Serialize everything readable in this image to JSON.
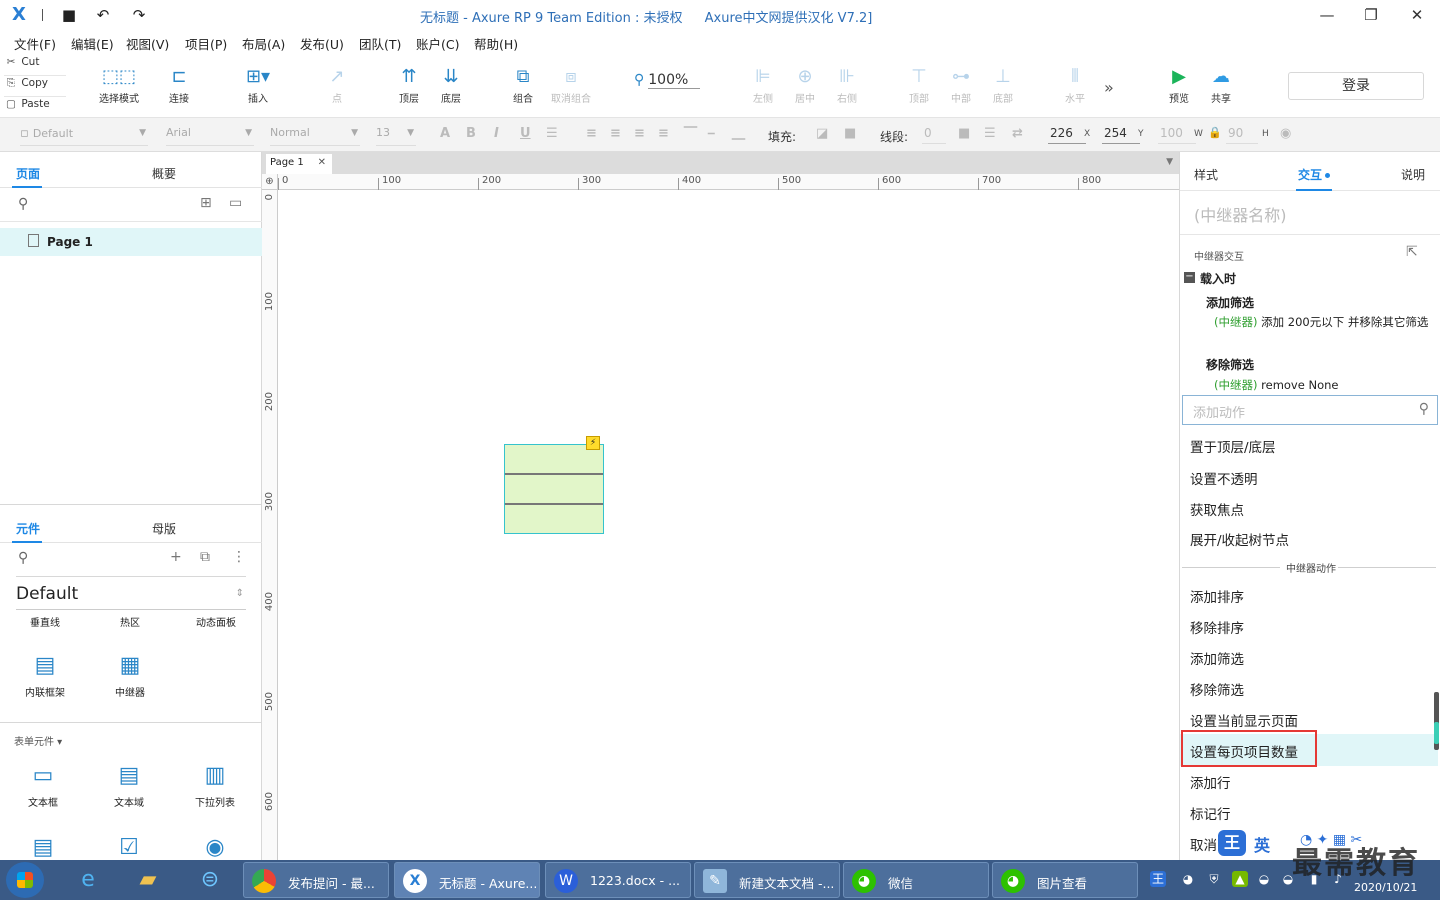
{
  "titlebar": {
    "title": "无标题 - Axure RP 9 Team Edition : ",
    "unlicensed": "未授权",
    "translation": "Axure中文网提供汉化 V7.2]"
  },
  "menu": [
    "文件(F)",
    "编辑(E)",
    "视图(V)",
    "项目(P)",
    "布局(A)",
    "发布(U)",
    "团队(T)",
    "账户(C)",
    "帮助(H)"
  ],
  "clipboard": {
    "cut": "Cut",
    "copy": "Copy",
    "paste": "Paste"
  },
  "toolbar": {
    "select_mode": "选择模式",
    "connect": "连接",
    "insert": "插入",
    "point": "点",
    "top_layer": "顶层",
    "bottom_layer": "底层",
    "group": "组合",
    "ungroup": "取消组合",
    "zoom": "100%",
    "align_left": "左侧",
    "align_center": "居中",
    "align_right": "右侧",
    "align_top": "顶部",
    "align_middle": "中部",
    "align_bottom": "底部",
    "horizontal": "水平",
    "preview": "预览",
    "share": "共享",
    "login": "登录"
  },
  "formatbar": {
    "style": "Default",
    "font": "Arial",
    "weight": "Normal",
    "size": "13",
    "fill_label": "填充:",
    "line_label": "线段:",
    "line_value": "0",
    "x": "226",
    "x_suffix": "X",
    "y": "254",
    "y_suffix": "Y",
    "w": "100",
    "w_suffix": "W",
    "h": "90",
    "h_suffix": "H"
  },
  "left": {
    "tab_pages": "页面",
    "tab_outline": "概要",
    "page_item": "Page 1",
    "tab_widgets": "元件",
    "tab_masters": "母版",
    "library": "Default",
    "widgets_row1": [
      "垂直线",
      "热区",
      "动态面板"
    ],
    "widgets_row2": [
      "内联框架",
      "中继器"
    ],
    "form_section": "表单元件 ▾",
    "form_widgets": [
      "文本框",
      "文本域",
      "下拉列表"
    ]
  },
  "canvas": {
    "doc_tab": "Page 1",
    "hruler": [
      "0",
      "100",
      "200",
      "300",
      "400",
      "500",
      "600",
      "700",
      "800"
    ],
    "vruler": [
      "0",
      "100",
      "200",
      "300",
      "400",
      "500",
      "600"
    ]
  },
  "right": {
    "tab_style": "样式",
    "tab_interact": "交互",
    "tab_notes": "说明",
    "repeater_name_placeholder": "(中继器名称)",
    "section": "中继器交互",
    "event": "载入时",
    "case1": "添加筛选",
    "case1_target": "(中继器)",
    "case1_desc": " 添加 200元以下 并移除其它筛选",
    "case2": "移除筛选",
    "case2_target": "(中继器)",
    "case2_desc": " remove None",
    "add_action_placeholder": "添加动作",
    "actions_top": [
      "置于顶层/底层",
      "设置不透明",
      "获取焦点",
      "展开/收起树节点"
    ],
    "group_header": "中继器动作",
    "actions_repeater": [
      "添加排序",
      "移除排序",
      "添加筛选",
      "移除筛选",
      "设置当前显示页面",
      "设置每页项目数量",
      "添加行",
      "标记行",
      "取消"
    ]
  },
  "taskbar": {
    "tasks": [
      "发布提问 - 最...",
      "无标题 - Axure...",
      "1223.docx - ...",
      "新建文本文档 -...",
      "微信",
      "图片查看"
    ],
    "date": "2020/10/21"
  },
  "overlay": {
    "ime_icon": "王",
    "ime_lang": "英",
    "watermark": "最需教育"
  }
}
